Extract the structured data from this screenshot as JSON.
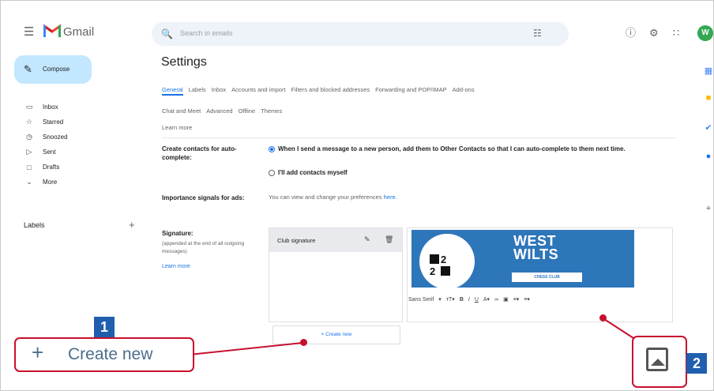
{
  "app": {
    "name": "Gmail",
    "avatar_letter": "W"
  },
  "search": {
    "placeholder": "Search in emails"
  },
  "nav": {
    "compose": "Compose",
    "items": [
      {
        "icon": "inbox-icon",
        "label": "Inbox"
      },
      {
        "icon": "star-icon",
        "label": "Starred"
      },
      {
        "icon": "clock-icon",
        "label": "Snoozed"
      },
      {
        "icon": "send-icon",
        "label": "Sent"
      },
      {
        "icon": "draft-icon",
        "label": "Drafts"
      },
      {
        "icon": "chevron-down-icon",
        "label": "More"
      }
    ],
    "labels_heading": "Labels"
  },
  "settings": {
    "title": "Settings",
    "tabs": [
      "General",
      "Labels",
      "Inbox",
      "Accounts and import",
      "Filters and blocked addresses",
      "Forwarding and POP/IMAP",
      "Add-ons"
    ],
    "tabs_row2": [
      "Chat and Meet",
      "Advanced",
      "Offline",
      "Themes"
    ],
    "learn_more": "Learn more",
    "create_contacts": {
      "label": "Create contacts for auto-complete:",
      "option1": "When I send a message to a new person, add them to Other Contacts so that I can auto-complete to them next time.",
      "option2": "I'll add contacts myself"
    },
    "importance": {
      "label": "Importance signals for ads:",
      "text": "You can view and change your preferences",
      "link": "here."
    },
    "signature": {
      "label": "Signature:",
      "sublabel": "(appended at the end of all outgoing messages)",
      "learn_more": "Learn more",
      "entry_name": "Club signature",
      "create_new": "Create new",
      "banner_line1": "WEST",
      "banner_line2": "WILTS",
      "banner_sub": "CHESS CLUB",
      "badge_digits": [
        "2",
        "2"
      ],
      "toolbar": {
        "font": "Sans Serif"
      }
    }
  },
  "callouts": {
    "one": {
      "number": "1",
      "text": "Create new"
    },
    "two": {
      "number": "2"
    }
  },
  "colors": {
    "accent": "#c8102e",
    "badge": "#1f5fad",
    "banner": "#2e76ba",
    "compose": "#c2e7ff"
  }
}
